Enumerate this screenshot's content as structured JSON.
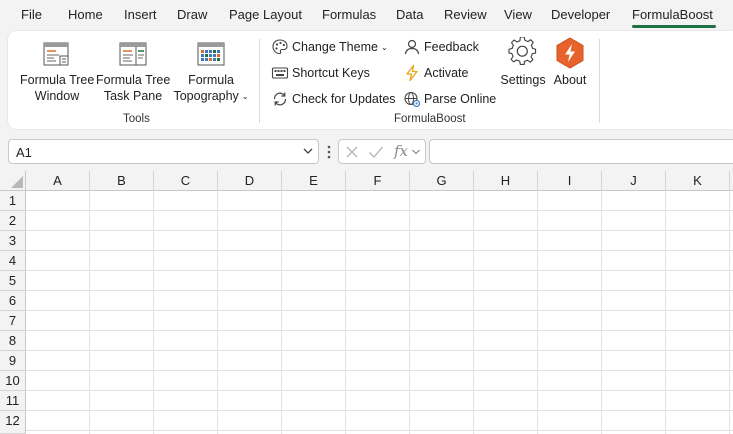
{
  "tabs": [
    {
      "label": "File"
    },
    {
      "label": "Home"
    },
    {
      "label": "Insert"
    },
    {
      "label": "Draw"
    },
    {
      "label": "Page Layout"
    },
    {
      "label": "Formulas"
    },
    {
      "label": "Data"
    },
    {
      "label": "Review"
    },
    {
      "label": "View"
    },
    {
      "label": "Developer"
    },
    {
      "label": "FormulaBoost"
    }
  ],
  "ribbon": {
    "tools_group": {
      "label": "Tools",
      "formula_tree_window": {
        "line1": "Formula Tree",
        "line2": "Window"
      },
      "formula_tree_task_pane": {
        "line1": "Formula Tree",
        "line2": "Task Pane"
      },
      "formula_topography": {
        "line1": "Formula",
        "line2": "Topography"
      }
    },
    "formulaboost_group": {
      "label": "FormulaBoost",
      "change_theme": "Change Theme",
      "shortcut_keys": "Shortcut Keys",
      "check_for_updates": "Check for Updates",
      "feedback": "Feedback",
      "activate": "Activate",
      "parse_online": "Parse Online",
      "settings": "Settings",
      "about": "About"
    },
    "colors": {
      "accent": "#1e7145",
      "about_orange": "#e8632b",
      "activate_yellow": "#e8a317"
    }
  },
  "formula_bar": {
    "name_box": "A1",
    "fx": "fx"
  },
  "grid": {
    "columns": [
      "A",
      "B",
      "C",
      "D",
      "E",
      "F",
      "G",
      "H",
      "I",
      "J",
      "K"
    ],
    "rows": [
      "1",
      "2",
      "3",
      "4",
      "5",
      "6",
      "7",
      "8",
      "9",
      "10",
      "11",
      "12"
    ]
  }
}
